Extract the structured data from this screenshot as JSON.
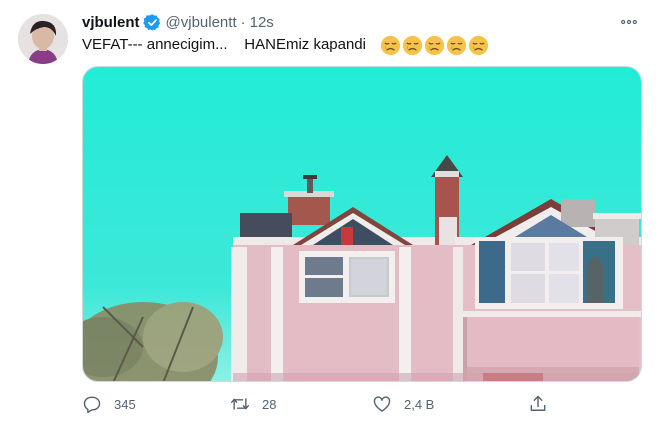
{
  "tweet": {
    "author_name": "vjbulent",
    "handle": "@vjbulentt",
    "separator": "·",
    "time": "12s",
    "text": "VEFAT--- annecigim...    HANEmiz kapandi",
    "emoji_count": 5
  },
  "actions": {
    "replies": "345",
    "retweets": "28",
    "likes": "2,4 B"
  },
  "icons": {
    "verified": "verified-badge-icon",
    "more": "more-icon",
    "reply": "reply-icon",
    "retweet": "retweet-icon",
    "like": "heart-icon",
    "share": "share-icon",
    "emoji": "sad-face-emoji-icon"
  },
  "colors": {
    "verified_blue": "#1d9bf0",
    "secondary_text": "#536471",
    "sky": "#25e8d1",
    "house_wall": "#e3bcc6"
  }
}
